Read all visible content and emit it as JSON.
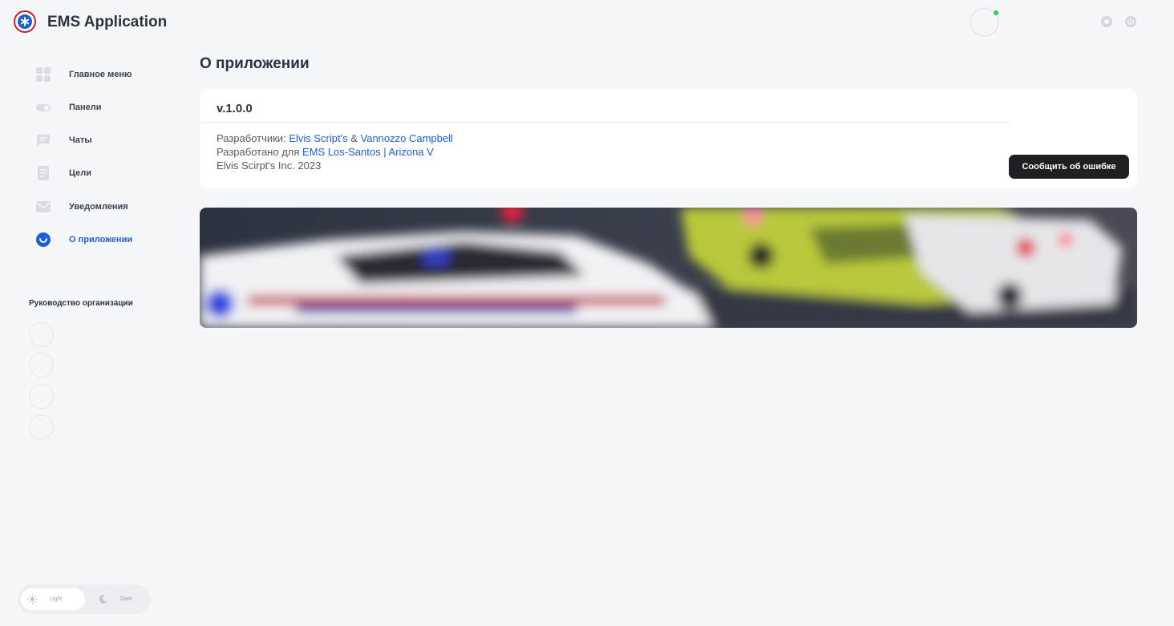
{
  "header": {
    "app_title": "EMS Application",
    "logo_icon": "star-of-life-icon",
    "status": "online",
    "status_color": "#2ecc55",
    "actions": [
      "settings-icon",
      "power-icon"
    ]
  },
  "sidebar": {
    "items": [
      {
        "label": "Главное меню",
        "icon": "grid-icon",
        "active": false
      },
      {
        "label": "Панели",
        "icon": "toggle-icon",
        "active": false
      },
      {
        "label": "Чаты",
        "icon": "chat-icon",
        "active": false
      },
      {
        "label": "Цели",
        "icon": "checklist-icon",
        "active": false
      },
      {
        "label": "Уведомления",
        "icon": "mail-icon",
        "active": false
      },
      {
        "label": "О приложении",
        "icon": "info-icon",
        "active": true
      }
    ],
    "leadership_title": "Руководство организации",
    "leaders_count": 4,
    "theme": {
      "light_label": "Light",
      "dark_label": "Dark",
      "selected": "light"
    }
  },
  "main": {
    "title": "О приложении",
    "about": {
      "version": "v.1.0.0",
      "developers_prefix": "Разработчики:",
      "developer_1": "Elvis Script's",
      "developers_and": "&",
      "developer_2": "Vannozzo Campbell",
      "made_for_prefix": "Разработано для",
      "made_for": "EMS Los-Santos | Arizona V",
      "copyright": "Elvis Scirpt's Inc. 2023",
      "report_button": "Сообщить об ошибке"
    },
    "banner": "blurred-emergency-vehicles-image"
  },
  "colors": {
    "accent": "#1f5fd6",
    "background": "#f6f7f9",
    "button": "#1e1f22"
  }
}
